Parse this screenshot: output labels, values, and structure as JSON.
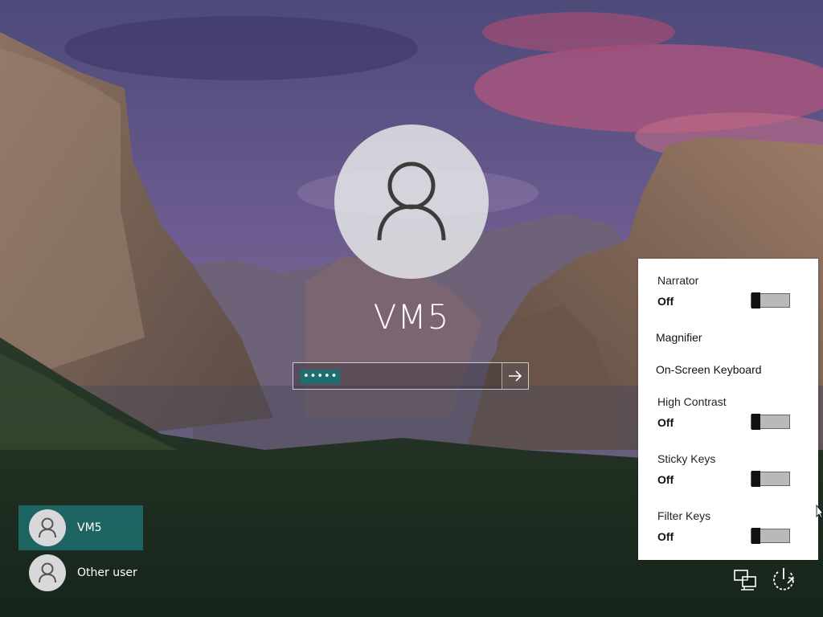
{
  "lockscreen": {
    "account_name": "VM5",
    "password": {
      "masked_value": "•••••",
      "submit_icon": "arrow-right-icon"
    }
  },
  "users": [
    {
      "label": "VM5",
      "selected": true,
      "icon": "user-icon"
    },
    {
      "label": "Other user",
      "selected": false,
      "icon": "user-icon"
    }
  ],
  "ease_of_access": {
    "items": [
      {
        "label": "Narrator",
        "state": "Off",
        "has_toggle": true
      },
      {
        "label": "Magnifier",
        "has_toggle": false
      },
      {
        "label": "On-Screen Keyboard",
        "has_toggle": false
      },
      {
        "label": "High Contrast",
        "state": "Off",
        "has_toggle": true
      },
      {
        "label": "Sticky Keys",
        "state": "Off",
        "has_toggle": true
      },
      {
        "label": "Filter Keys",
        "state": "Off",
        "has_toggle": true
      }
    ]
  },
  "tray": {
    "network_icon": "network-icon",
    "power_icon": "power-icon"
  },
  "colors": {
    "selection_accent": "#1e6e70",
    "panel_bg": "#ffffff"
  }
}
